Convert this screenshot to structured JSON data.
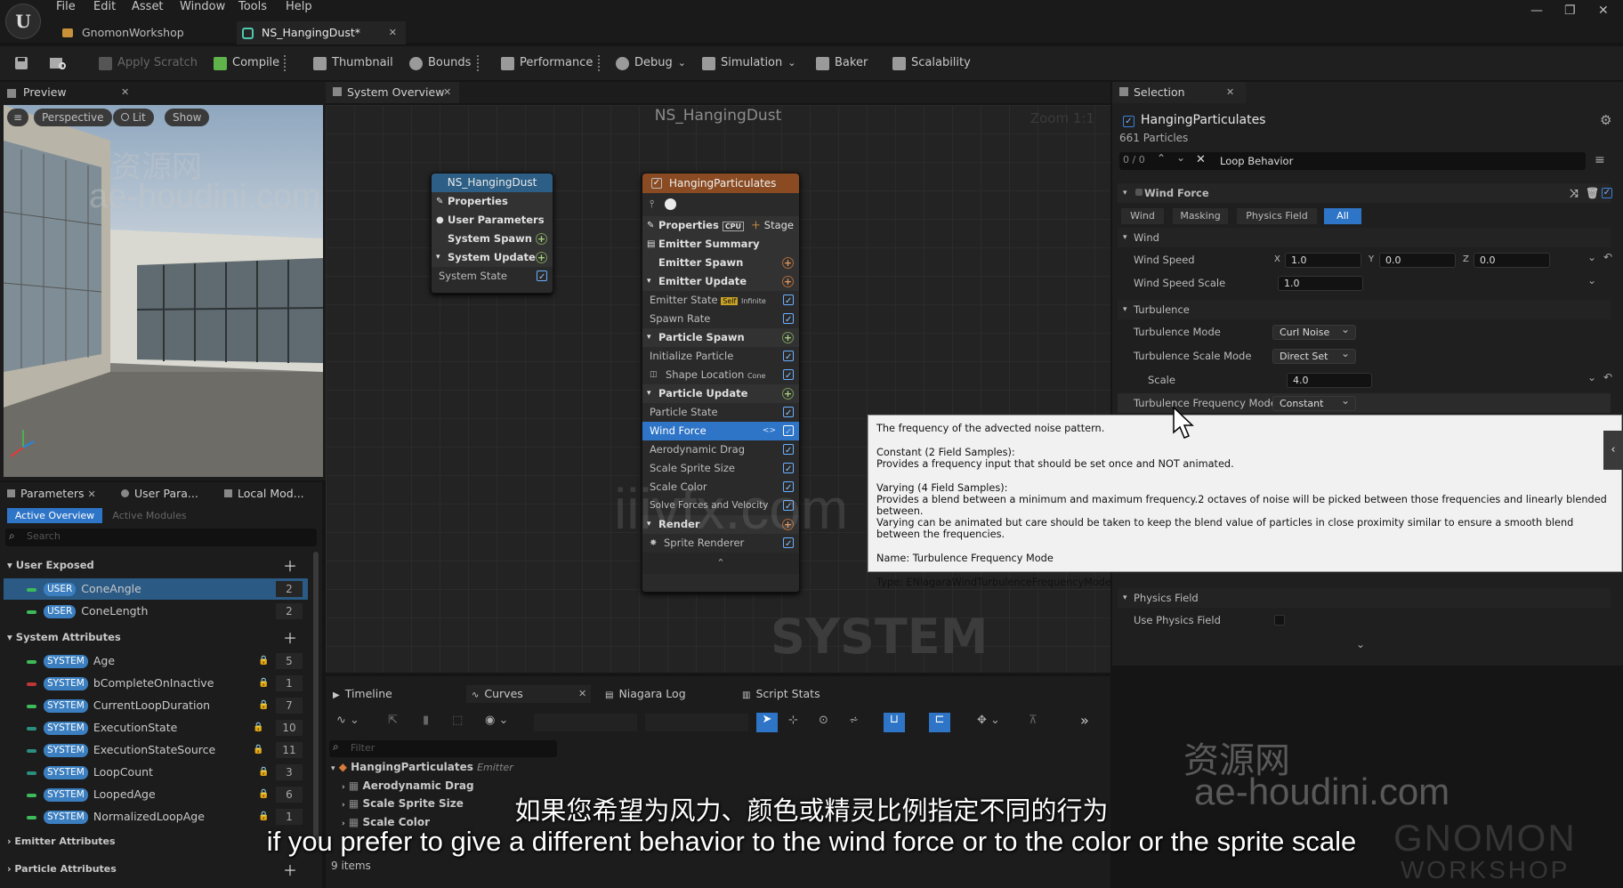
{
  "menu": [
    "File",
    "Edit",
    "Asset",
    "Window",
    "Tools",
    "Help"
  ],
  "doc_tabs": [
    {
      "label": "GnomonWorkshop"
    },
    {
      "label": "NS_HangingDust*"
    }
  ],
  "toolbar": {
    "apply_scratch": "Apply Scratch",
    "compile": "Compile",
    "thumbnail": "Thumbnail",
    "bounds": "Bounds",
    "performance": "Performance",
    "debug": "Debug",
    "simulation": "Simulation",
    "baker": "Baker",
    "scalability": "Scalability"
  },
  "preview": {
    "tab": "Preview",
    "perspective": "Perspective",
    "lit": "Lit",
    "show": "Show"
  },
  "params": {
    "tabs": [
      "Parameters",
      "User Para...",
      "Local Mod..."
    ],
    "active_overview": "Active Overview",
    "active_modules": "Active Modules",
    "search_placeholder": "Search",
    "user_exposed": "User Exposed",
    "user_rows": [
      {
        "tag": "USER",
        "name": "ConeAngle",
        "count": "2"
      },
      {
        "tag": "USER",
        "name": "ConeLength",
        "count": "2"
      }
    ],
    "system_attributes": "System Attributes",
    "system_rows": [
      {
        "tag": "SYSTEM",
        "name": "Age",
        "count": "5"
      },
      {
        "tag": "SYSTEM",
        "name": "bCompleteOnInactive",
        "count": "1"
      },
      {
        "tag": "SYSTEM",
        "name": "CurrentLoopDuration",
        "count": "7"
      },
      {
        "tag": "SYSTEM",
        "name": "ExecutionState",
        "count": "10"
      },
      {
        "tag": "SYSTEM",
        "name": "ExecutionStateSource",
        "count": "11"
      },
      {
        "tag": "SYSTEM",
        "name": "LoopCount",
        "count": "3"
      },
      {
        "tag": "SYSTEM",
        "name": "LoopedAge",
        "count": "6"
      },
      {
        "tag": "SYSTEM",
        "name": "NormalizedLoopAge",
        "count": "1"
      }
    ],
    "emitter_attributes": "Emitter Attributes",
    "particle_attributes": "Particle Attributes"
  },
  "graph": {
    "tab": "System Overview",
    "title": "NS_HangingDust",
    "zoom": "Zoom 1:1",
    "watermark_label": "SYSTEM",
    "system_node": {
      "title": "NS_HangingDust",
      "rows": [
        "Properties",
        "User Parameters",
        "System Spawn",
        "System Update",
        "System State"
      ]
    },
    "emitter_node": {
      "title": "HangingParticulates",
      "properties": "Properties",
      "cpu": "CPU",
      "stage": "Stage",
      "emitter_summary": "Emitter Summary",
      "emitter_spawn": "Emitter Spawn",
      "emitter_update": "Emitter Update",
      "emitter_state": "Emitter State",
      "self": "Self",
      "infinite": "Infinite",
      "spawn_rate": "Spawn Rate",
      "particle_spawn": "Particle Spawn",
      "initialize_particle": "Initialize Particle",
      "shape_location": "Shape Location",
      "cone": "Cone",
      "particle_update": "Particle Update",
      "particle_state": "Particle State",
      "wind_force": "Wind Force",
      "aerodynamic_drag": "Aerodynamic Drag",
      "scale_sprite_size": "Scale Sprite Size",
      "scale_color": "Scale Color",
      "solve_forces": "Solve Forces and Velocity",
      "render": "Render",
      "sprite_renderer": "Sprite Renderer"
    }
  },
  "selection": {
    "tab": "Selection",
    "emitter_name": "HangingParticulates",
    "particles": "661 Particles",
    "search_count": "0 / 0",
    "search_value": "Loop Behavior",
    "wind_force": "Wind Force",
    "filters": [
      "Wind",
      "Masking",
      "Physics Field",
      "All"
    ],
    "wind": "Wind",
    "wind_speed_label": "Wind Speed",
    "wind_speed": {
      "x_label": "X",
      "x": "1.0",
      "y_label": "Y",
      "y": "0.0",
      "z_label": "Z",
      "z": "0.0"
    },
    "wind_speed_scale_label": "Wind Speed Scale",
    "wind_speed_scale": "1.0",
    "turbulence": "Turbulence",
    "turbulence_mode_label": "Turbulence Mode",
    "turbulence_mode": "Curl Noise",
    "turbulence_scale_mode_label": "Turbulence Scale Mode",
    "turbulence_scale_mode": "Direct Set",
    "scale_label": "Scale",
    "scale": "4.0",
    "turbulence_freq_label": "Turbulence Frequency Mode",
    "turbulence_freq": "Constant",
    "physics_field": "Physics Field",
    "use_physics_field": "Use Physics Field"
  },
  "tooltip": {
    "line1": "The frequency of the advected noise pattern.",
    "line2": "Constant (2 Field Samples):",
    "line3": "Provides a frequency input that should be set once and NOT animated.",
    "line4": "Varying (4 Field Samples):",
    "line5": "Provides a blend between a minimum and maximum frequency.2 octaves of noise will be picked between those frequencies and linearly blended between.",
    "line6": "Varying can be animated but care should be taken to keep the blend value of particles in close proximity similar to ensure a smooth blend between the frequencies.",
    "line7": "Name: Turbulence Frequency Mode",
    "line8": "Type: ENiagaraWindTurbulenceFrequencyMode"
  },
  "bottom": {
    "tabs": [
      "Timeline",
      "Curves",
      "Niagara Log",
      "Script Stats"
    ],
    "filter_placeholder": "Filter",
    "tree_root": "HangingParticulates",
    "tree_root_type": "Emitter",
    "tree_items": [
      "Aerodynamic Drag",
      "Scale Sprite Size",
      "Scale Color"
    ],
    "items_count": "9 items"
  },
  "subtitles": {
    "chinese": "如果您希望为风力、颜色或精灵比例指定不同的行为",
    "english": "if you prefer to give a different behavior to the wind force or to the color or the sprite scale"
  },
  "watermarks": {
    "cn": "资源网",
    "site": "ae-houdini.com",
    "center": "iiivfx.com",
    "brand_top": "GNOMON",
    "brand_bottom": "WORKSHOP"
  }
}
